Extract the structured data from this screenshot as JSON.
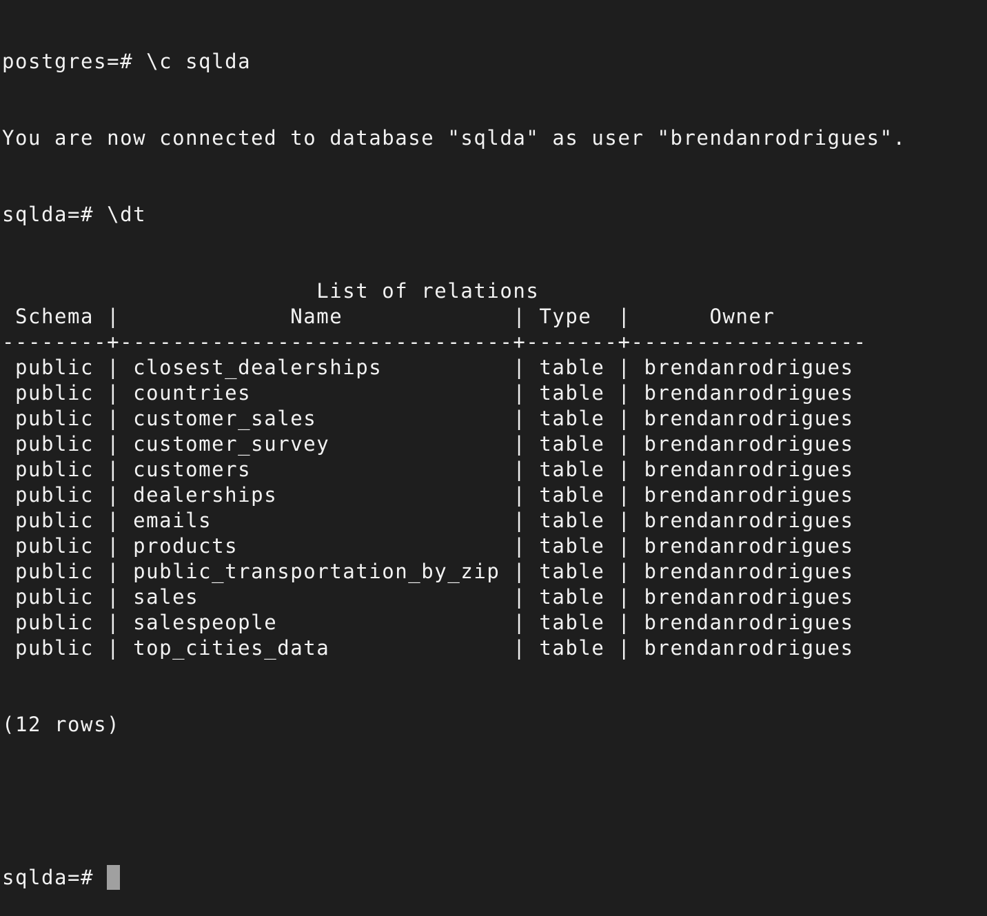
{
  "terminal": {
    "colors": {
      "background": "#1e1e1e",
      "foreground": "#f2f2f2",
      "cursor": "#a0a0a0"
    },
    "session": [
      {
        "prompt": "postgres=# ",
        "command": "\\c sqlda"
      },
      {
        "output": "You are now connected to database \"sqlda\" as user \"brendanrodrigues\"."
      },
      {
        "prompt": "sqlda=# ",
        "command": "\\dt"
      }
    ],
    "table": {
      "title": "List of relations",
      "columns": [
        "Schema",
        "Name",
        "Type",
        "Owner"
      ],
      "rows": [
        [
          "public",
          "closest_dealerships",
          "table",
          "brendanrodrigues"
        ],
        [
          "public",
          "countries",
          "table",
          "brendanrodrigues"
        ],
        [
          "public",
          "customer_sales",
          "table",
          "brendanrodrigues"
        ],
        [
          "public",
          "customer_survey",
          "table",
          "brendanrodrigues"
        ],
        [
          "public",
          "customers",
          "table",
          "brendanrodrigues"
        ],
        [
          "public",
          "dealerships",
          "table",
          "brendanrodrigues"
        ],
        [
          "public",
          "emails",
          "table",
          "brendanrodrigues"
        ],
        [
          "public",
          "products",
          "table",
          "brendanrodrigues"
        ],
        [
          "public",
          "public_transportation_by_zip",
          "table",
          "brendanrodrigues"
        ],
        [
          "public",
          "sales",
          "table",
          "brendanrodrigues"
        ],
        [
          "public",
          "salespeople",
          "table",
          "brendanrodrigues"
        ],
        [
          "public",
          "top_cities_data",
          "table",
          "brendanrodrigues"
        ]
      ],
      "footer": "(12 rows)"
    },
    "current_prompt": "sqlda=# ",
    "current_input": ""
  }
}
